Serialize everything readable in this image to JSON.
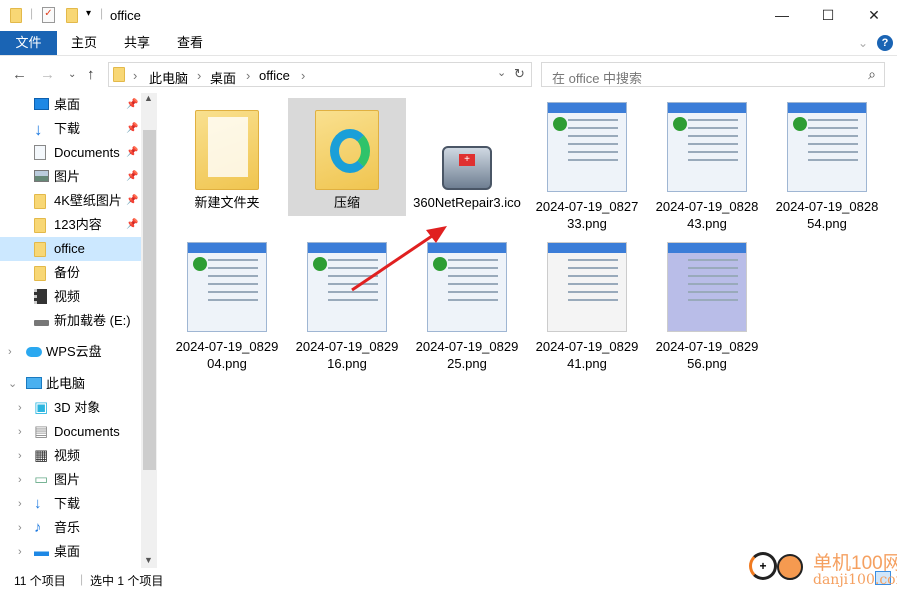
{
  "window": {
    "title": "office",
    "minimize": "—",
    "maximize": "☐",
    "close": "✕"
  },
  "ribbon": {
    "tabs": [
      "文件",
      "主页",
      "共享",
      "查看"
    ],
    "help": "?"
  },
  "address": {
    "crumbs": [
      "此电脑",
      "桌面",
      "office"
    ],
    "search_placeholder": "在 office 中搜索"
  },
  "sidebar": {
    "quick": [
      {
        "label": "桌面",
        "icon": "desktop-icon",
        "pinned": true
      },
      {
        "label": "下载",
        "icon": "download-icon",
        "pinned": true
      },
      {
        "label": "Documents",
        "icon": "document-icon",
        "pinned": true
      },
      {
        "label": "图片",
        "icon": "pictures-icon",
        "pinned": true
      },
      {
        "label": "4K壁纸图片",
        "icon": "folder-icon",
        "pinned": true
      },
      {
        "label": "123内容",
        "icon": "folder-icon",
        "pinned": true
      },
      {
        "label": "office",
        "icon": "folder-icon",
        "selected": true
      },
      {
        "label": "备份",
        "icon": "folder-icon"
      },
      {
        "label": "视频",
        "icon": "video-icon"
      },
      {
        "label": "新加载卷 (E:)",
        "icon": "drive-icon"
      }
    ],
    "wps": "WPS云盘",
    "pc": "此电脑",
    "pc_items": [
      "3D 对象",
      "Documents",
      "视频",
      "图片",
      "下载",
      "音乐",
      "桌面"
    ]
  },
  "files": [
    {
      "name": "新建文件夹",
      "type": "folder"
    },
    {
      "name": "压缩",
      "type": "folder-edge",
      "selected": true
    },
    {
      "name": "360NetRepair3.ico",
      "type": "ico"
    },
    {
      "name": "2024-07-19_082733.png",
      "type": "png"
    },
    {
      "name": "2024-07-19_082843.png",
      "type": "png"
    },
    {
      "name": "2024-07-19_082854.png",
      "type": "png"
    },
    {
      "name": "2024-07-19_082904.png",
      "type": "png"
    },
    {
      "name": "2024-07-19_082916.png",
      "type": "png"
    },
    {
      "name": "2024-07-19_082925.png",
      "type": "png"
    },
    {
      "name": "2024-07-19_082941.png",
      "type": "png"
    },
    {
      "name": "2024-07-19_082956.png",
      "type": "png"
    }
  ],
  "status": {
    "count": "11 个项目",
    "selected": "选中 1 个项目"
  },
  "watermark": {
    "text": "单机100网",
    "url": "danji100.com"
  },
  "colors": {
    "accent": "#1a64b4",
    "selection": "#cce8ff",
    "arrow": "#e02020"
  }
}
